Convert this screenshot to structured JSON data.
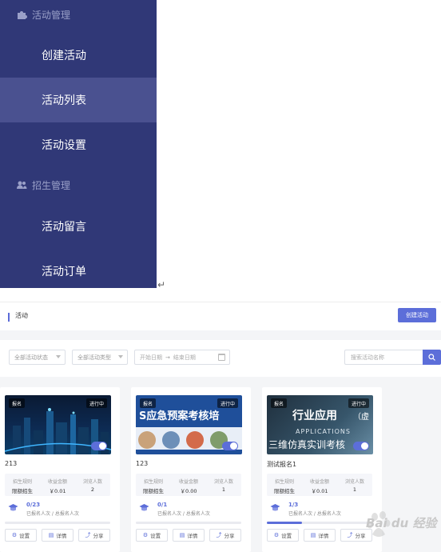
{
  "sidebar": {
    "groups": [
      {
        "label": "活动管理",
        "icon": "puzzle-icon"
      },
      {
        "label": "招生管理",
        "icon": "users-icon"
      }
    ],
    "items": [
      {
        "label": "创建活动"
      },
      {
        "label": "活动列表",
        "active": true
      },
      {
        "label": "活动设置"
      },
      {
        "label": "活动留言"
      },
      {
        "label": "活动订单"
      }
    ]
  },
  "return_mark": "↵",
  "header": {
    "title": "活动",
    "create_button": "创建活动"
  },
  "filters": {
    "status": "全部活动状态",
    "type": "全部活动类型",
    "start_placeholder": "开始日期",
    "arrow": "→",
    "end_placeholder": "结束日期",
    "search_placeholder": "搜索活动名称"
  },
  "cards": [
    {
      "tag_left": "报名",
      "tag_right": "进行中",
      "name": "213",
      "stats": [
        {
          "k": "招生规则",
          "v": "限额招生"
        },
        {
          "k": "收益金额",
          "v": "￥0.01"
        },
        {
          "k": "浏览人数",
          "v": "2"
        }
      ],
      "count": "0/23",
      "desc": "已报名人次 / 总报名人次",
      "progress": 0,
      "thumb_text": []
    },
    {
      "tag_left": "报名",
      "tag_right": "进行中",
      "name": "123",
      "stats": [
        {
          "k": "招生规则",
          "v": "限额招生"
        },
        {
          "k": "收益金额",
          "v": "￥0.00"
        },
        {
          "k": "浏览人数",
          "v": "1"
        }
      ],
      "count": "0/1",
      "desc": "已报名人次 / 总报名人次",
      "progress": 0,
      "thumb_text": [
        "S应急预案考核培"
      ]
    },
    {
      "tag_left": "报名",
      "tag_right": "进行中",
      "name": "测试报名1",
      "stats": [
        {
          "k": "招生规则",
          "v": "限额招生"
        },
        {
          "k": "收益金额",
          "v": "￥0.01"
        },
        {
          "k": "浏览人数",
          "v": "1"
        }
      ],
      "count": "1/3",
      "desc": "已报名人次 / 总报名人次",
      "progress": 0.33,
      "thumb_text": [
        "行业应用",
        "（虚",
        "APPLICATIONS",
        "三维仿真实训考核"
      ]
    }
  ],
  "actions": {
    "settings": "设置",
    "detail": "详情",
    "share": "分享"
  },
  "watermark": "Bai du 经验",
  "colors": {
    "sidebar": "#303877",
    "active": "#4a5190",
    "accent": "#5c6ed9"
  }
}
